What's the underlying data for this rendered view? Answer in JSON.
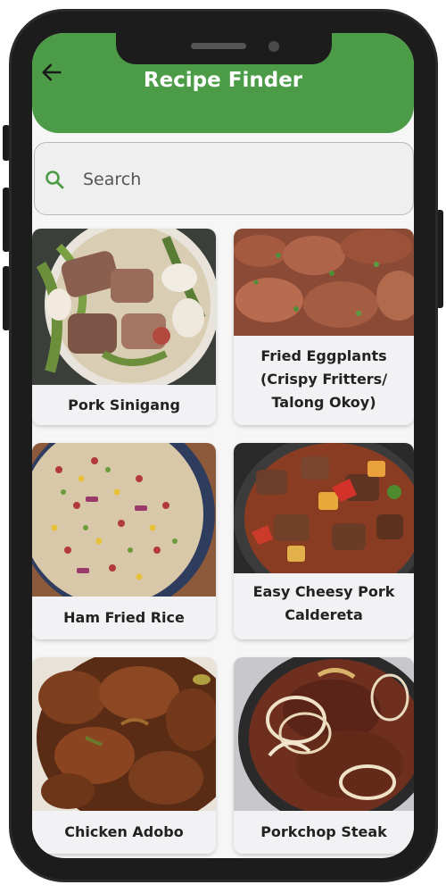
{
  "header": {
    "title": "Recipe Finder",
    "back_icon": "arrow-left-icon",
    "color": "#4c9c47"
  },
  "search": {
    "placeholder": "Search",
    "icon": "search-icon",
    "icon_color": "#4c9c47"
  },
  "recipes": [
    {
      "name": "Pork Sinigang"
    },
    {
      "name": "Fried Eggplants (Crispy Fritters/ Talong Okoy)"
    },
    {
      "name": "Ham Fried Rice"
    },
    {
      "name": "Easy Cheesy Pork Caldereta"
    },
    {
      "name": "Chicken Adobo"
    },
    {
      "name": "Porkchop Steak"
    }
  ]
}
